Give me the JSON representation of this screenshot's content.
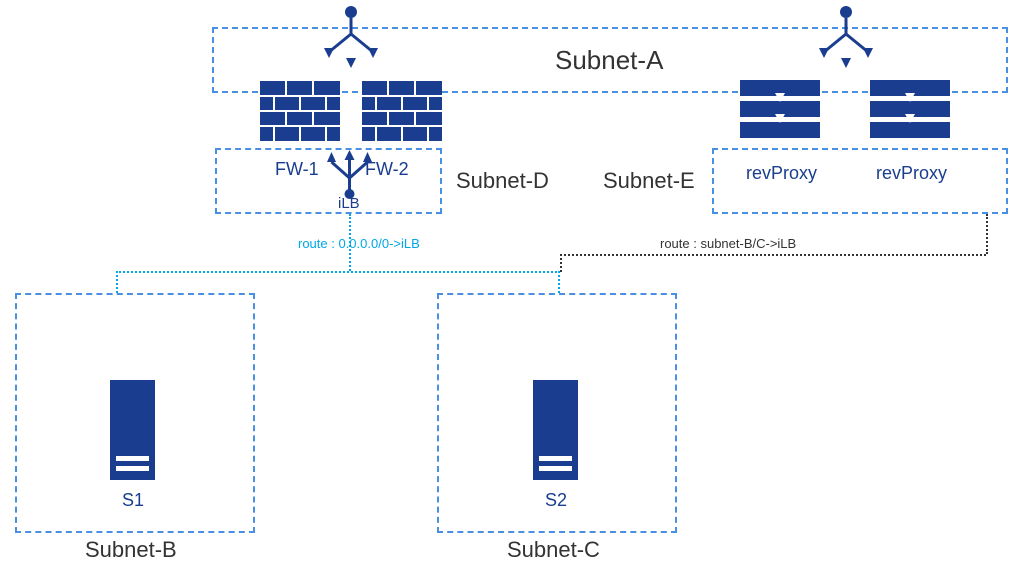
{
  "subnets": {
    "a": "Subnet-A",
    "b": "Subnet-B",
    "c": "Subnet-C",
    "d": "Subnet-D",
    "e": "Subnet-E"
  },
  "firewalls": {
    "fw1": "FW-1",
    "fw2": "FW-2"
  },
  "ilb": "iLB",
  "revproxy": {
    "label1": "revProxy",
    "label2": "revProxy"
  },
  "servers": {
    "s1": "S1",
    "s2": "S2"
  },
  "routes": {
    "left": "route : 0.0.0.0/0->iLB",
    "right": "route : subnet-B/C->iLB"
  },
  "colors": {
    "azure_blue": "#1a3d8f",
    "border_blue": "#4a90e2",
    "route_cyan": "#00a8e8",
    "route_dark": "#333"
  }
}
